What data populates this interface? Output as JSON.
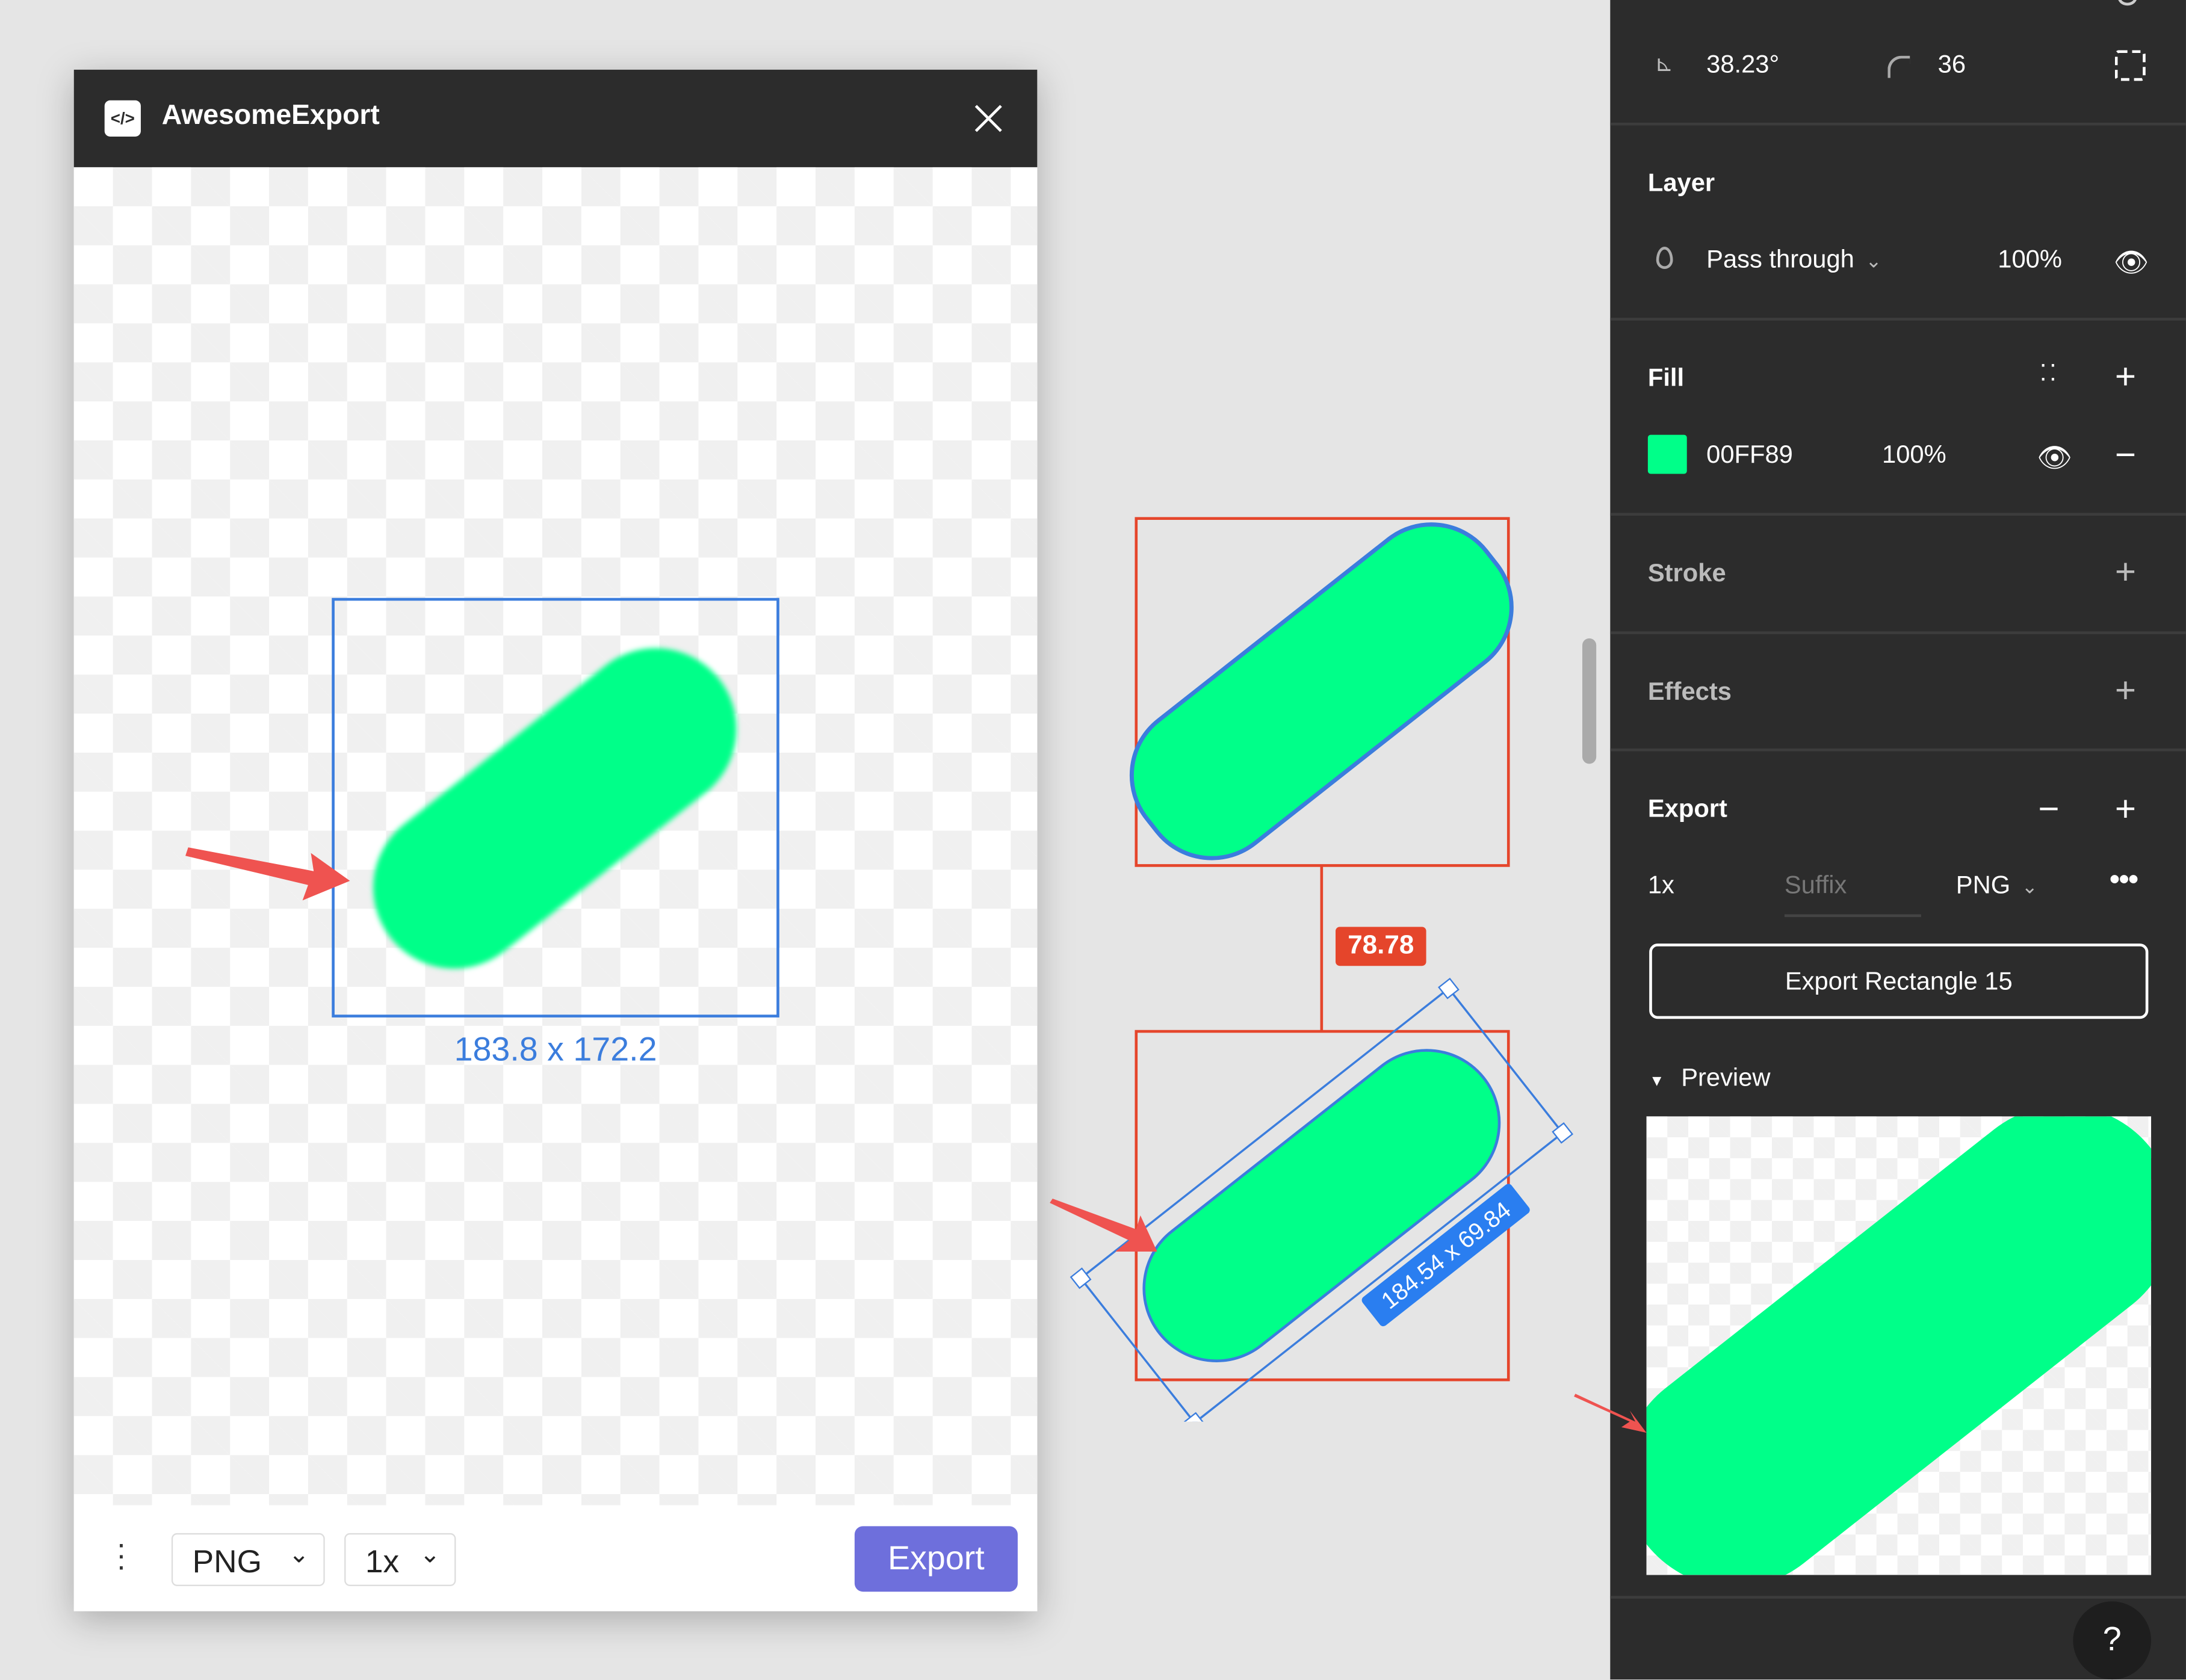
{
  "modal": {
    "title": "AwesomeExport",
    "dimension_label": "183.8 x 172.2",
    "format": "PNG",
    "scale": "1x",
    "export_label": "Export"
  },
  "canvas": {
    "distance_label": "78.78",
    "size_label": "184.54 x 69.84"
  },
  "panel": {
    "rotation": "38.23°",
    "corner_radius": "36",
    "layer": {
      "title": "Layer",
      "blend_mode": "Pass through",
      "opacity": "100%"
    },
    "fill": {
      "title": "Fill",
      "color_hex": "00FF89",
      "opacity": "100%",
      "swatch": "#00FF89"
    },
    "stroke": {
      "title": "Stroke"
    },
    "effects": {
      "title": "Effects"
    },
    "export": {
      "title": "Export",
      "scale": "1x",
      "suffix_placeholder": "Suffix",
      "format": "PNG",
      "button_label": "Export Rectangle 15",
      "preview_label": "Preview"
    },
    "help": "?"
  },
  "colors": {
    "shape": "#00FF89",
    "selection": "#3b7ddd",
    "measure": "#e5452b",
    "accent": "#6e6fdc"
  }
}
